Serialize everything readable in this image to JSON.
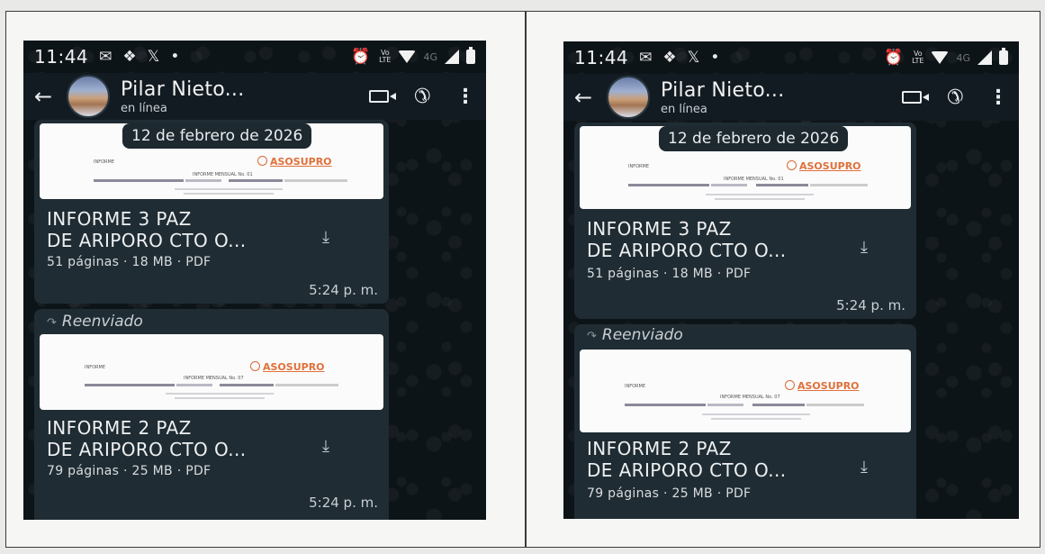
{
  "status_bar": {
    "time": "11:44",
    "icons": [
      "gmail-icon",
      "dropbox-icon",
      "x-icon",
      "dot-icon"
    ],
    "right_icons": [
      "alarm-icon",
      "volte-icon",
      "wifi-icon",
      "4g-icon",
      "signal-icon",
      "battery-icon"
    ],
    "volte_label": "Vo\nLTE",
    "net_label": "4G"
  },
  "header": {
    "contact_name": "Pilar Nieto...",
    "status": "en línea"
  },
  "date_chip": "12 de febrero de 2026",
  "messages": [
    {
      "forwarded": false,
      "preview": {
        "left_label": "INFORME",
        "logo": "ASOSUPRO",
        "center_text": "INFORME MENSUAL No. 01"
      },
      "title_line1": "INFORME 3 PAZ",
      "title_line2": "DE ARIPORO CTO O...",
      "meta": "51 páginas · 18 MB · PDF",
      "time": "5:24 p. m."
    },
    {
      "forwarded": true,
      "forwarded_label": "Reenviado",
      "preview": {
        "left_label": "INFORME",
        "logo": "ASOSUPRO",
        "center_text": "INFORME MENSUAL No. 07"
      },
      "title_line1": "INFORME 2 PAZ",
      "title_line2": "DE ARIPORO CTO O...",
      "meta": "79 páginas · 25 MB · PDF",
      "time": "5:24 p. m."
    }
  ]
}
